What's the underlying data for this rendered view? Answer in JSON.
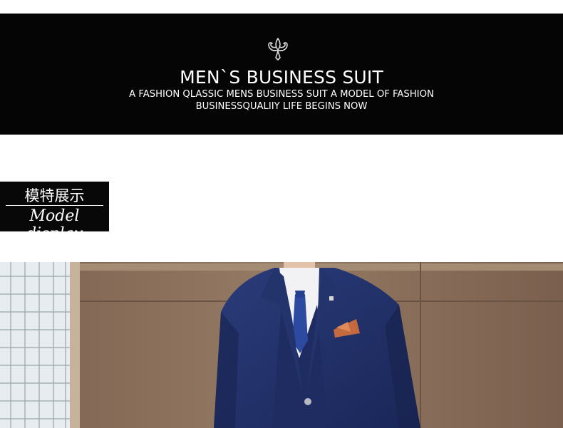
{
  "banner": {
    "icon": "fleur-de-lis-icon",
    "title": "MEN`S BUSINESS SUIT",
    "subtitle_line1": "A FASHION QLASSIC MENS BUSINESS SUIT A MODEL OF FASHION",
    "subtitle_line2": "BUSINESSQUALIIY LIFE BEGINS NOW"
  },
  "section_label": {
    "chinese": "模特展示",
    "english": "Model display"
  },
  "photo": {
    "subject": "model-in-navy-suit-photo"
  }
}
